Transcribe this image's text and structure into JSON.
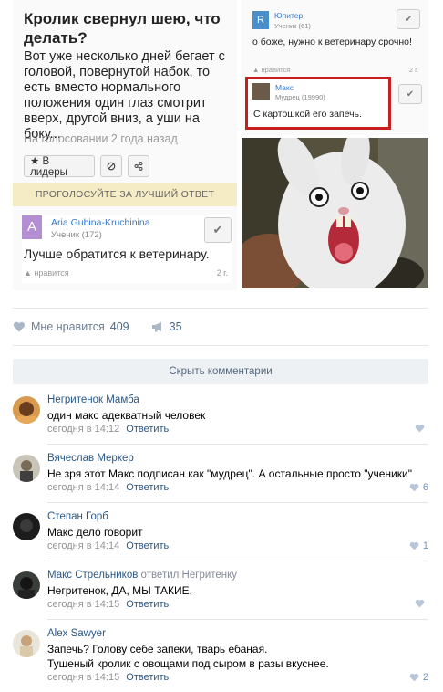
{
  "meme": {
    "question": {
      "title": "Кролик свернул шею, что делать?",
      "body": "Вот уже несколько дней бегает с головой, повернутой набок, то есть вместо нормального положения один глаз смотрит вверх, другой вниз, а уши на боку...",
      "meta": "На голосовании 2 года назад",
      "leaders_button": "★ В лидеры",
      "vote_banner": "ПРОГОЛОСУЙТЕ ЗА ЛУЧШИЙ ОТВЕТ"
    },
    "answer_main": {
      "avatar_letter": "A",
      "name": "Aria Gubina-Kruchinina",
      "rank": "Ученик (172)",
      "text": "Лучше обратится к ветеринару.",
      "like": "нравится",
      "time": "2 г."
    },
    "answer_jupiter": {
      "avatar_letter": "R",
      "name": "Юпитер",
      "rank": "Ученик (61)",
      "text": "о боже, нужно к ветеринару срочно!",
      "like": "нравится",
      "time": "2 г."
    },
    "answer_max": {
      "name": "Макс",
      "rank": "Мудрец (19990)",
      "text": "С картошкой его запечь."
    }
  },
  "reactions": {
    "likes_label": "Мне нравится",
    "likes_count": "409",
    "shares_count": "35"
  },
  "hide_comments_label": "Скрыть комментарии",
  "comments": [
    {
      "author": "Негритенок Мамба",
      "text": "один макс адекватный человек",
      "time": "сегодня в 14:12",
      "reply": "Ответить",
      "likes": ""
    },
    {
      "author": "Вячеслав Меркер",
      "text": "Не зря этот Макс подписан как \"мудрец\". А остальные просто \"ученики\"",
      "time": "сегодня в 14:14",
      "reply": "Ответить",
      "likes": "6"
    },
    {
      "author": "Степан Горб",
      "text": "Макс дело говорит",
      "time": "сегодня в 14:14",
      "reply": "Ответить",
      "likes": "1"
    },
    {
      "author": "Макс Стрельников",
      "replied_to": "ответил Негритенку",
      "text": "Негритенок, ДА, МЫ ТАКИЕ.",
      "time": "сегодня в 14:15",
      "reply": "Ответить",
      "likes": ""
    },
    {
      "author": "Alex Sawyer",
      "text_line1": "Запечь? Голову себе запеки, тварь ебаная.",
      "text_line2": "Тушеный кролик с овощами под сыром в разы вкуснее.",
      "time": "сегодня в 14:15",
      "reply": "Ответить",
      "likes": "2"
    }
  ]
}
